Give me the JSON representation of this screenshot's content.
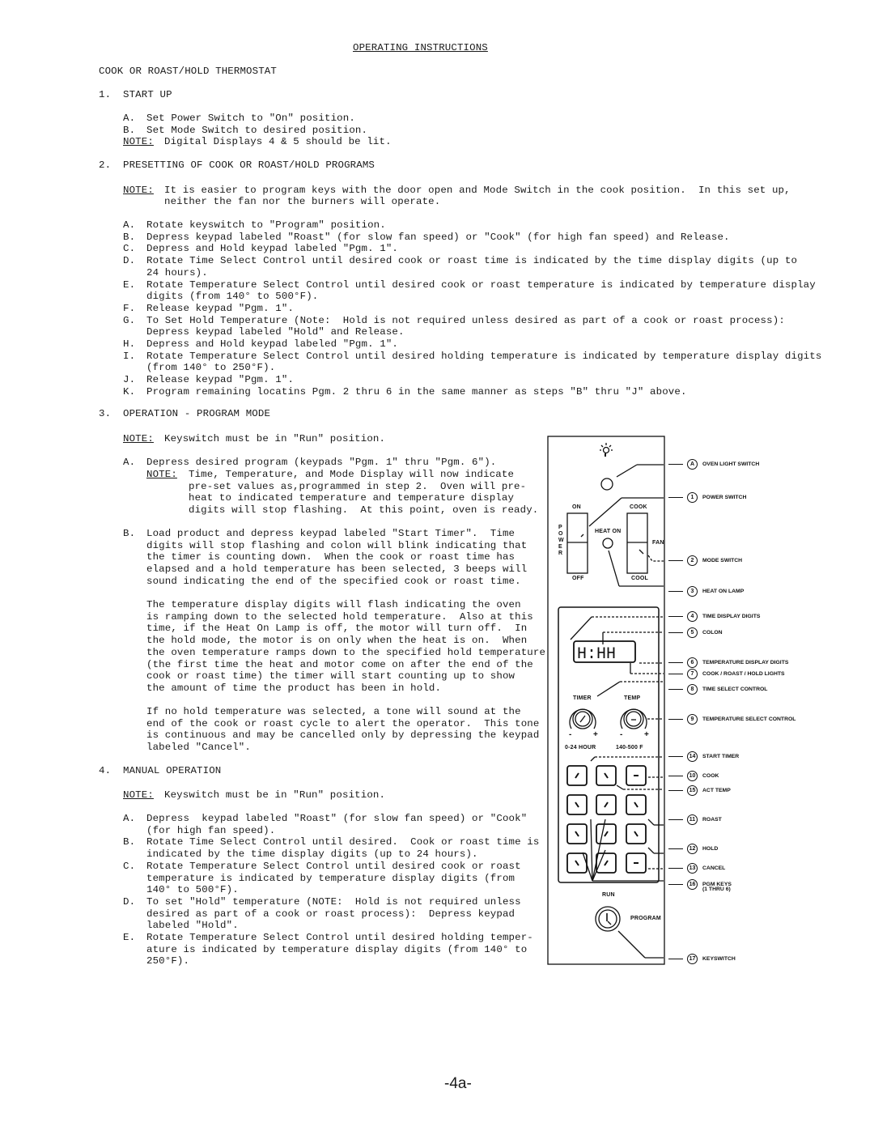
{
  "document": {
    "title": "OPERATING INSTRUCTIONS",
    "heading": "COOK OR ROAST/HOLD THERMOSTAT",
    "page_number": "-4a-",
    "sections": [
      {
        "number": "1.",
        "title": "START UP",
        "items": [
          {
            "letter": "A.",
            "text": "Set Power Switch to \"On\" position."
          },
          {
            "letter": "B.",
            "text": "Set Mode Switch to desired position."
          }
        ],
        "note_label": "NOTE:",
        "note": "Digital Displays 4 & 5 should be lit."
      },
      {
        "number": "2.",
        "title": "PRESETTING OF COOK OR ROAST/HOLD PROGRAMS",
        "note_label": "NOTE:",
        "note_lines": [
          "It is easier to program keys with the door open and Mode Switch in the cook position.  In this set up,",
          "neither the fan nor the burners will operate."
        ],
        "items": [
          {
            "letter": "A.",
            "lines": [
              "Rotate keyswitch to \"Program\" position."
            ]
          },
          {
            "letter": "B.",
            "lines": [
              "Depress keypad labeled \"Roast\" (for slow fan speed) or \"Cook\" (for high fan speed) and Release."
            ]
          },
          {
            "letter": "C.",
            "lines": [
              "Depress and Hold keypad labeled \"Pgm. 1\"."
            ]
          },
          {
            "letter": "D.",
            "lines": [
              "Rotate Time Select Control until desired cook or roast time is indicated by the time display digits (up to",
              "24 hours)."
            ]
          },
          {
            "letter": "E.",
            "lines": [
              "Rotate Temperature Select Control until desired cook or roast temperature is indicated by temperature display",
              "digits (from 140° to 500°F)."
            ]
          },
          {
            "letter": "F.",
            "lines": [
              "Release keypad \"Pgm. 1\"."
            ]
          },
          {
            "letter": "G.",
            "lines": [
              "To Set Hold Temperature (Note:  Hold is not required unless desired as part of a cook or roast process):",
              "Depress keypad labeled \"Hold\" and Release."
            ]
          },
          {
            "letter": "H.",
            "lines": [
              "Depress and Hold keypad labeled \"Pgm. 1\"."
            ]
          },
          {
            "letter": "I.",
            "lines": [
              "Rotate Temperature Select Control until desired holding temperature is indicated by temperature display digits",
              "(from 140° to 250°F)."
            ]
          },
          {
            "letter": "J.",
            "lines": [
              "Release keypad \"Pgm. 1\"."
            ]
          },
          {
            "letter": "K.",
            "lines": [
              "Program remaining locatins Pgm. 2 thru 6 in the same manner as steps \"B\" thru \"J\" above."
            ]
          }
        ]
      },
      {
        "number": "3.",
        "title": "OPERATION - PROGRAM MODE",
        "note_label": "NOTE:",
        "note": "Keyswitch must be in \"Run\" position.",
        "items": [
          {
            "letter": "A.",
            "lines": [
              "Depress desired program (keypads \"Pgm. 1\" thru \"Pgm. 6\")."
            ],
            "sub_note_label": "NOTE:",
            "sub_note_lines": [
              "Time, Temperature, and Mode Display will now indicate",
              "pre-set values as,programmed in step 2.  Oven will pre-",
              "heat to indicated temperature and temperature display",
              "digits will stop flashing.  At this point, oven is ready."
            ]
          },
          {
            "letter": "B.",
            "lines": [
              "Load product and depress keypad labeled \"Start Timer\".  Time",
              "digits will stop flashing and colon will blink indicating that",
              "the timer is counting down.  When the cook or roast time has",
              "elapsed and a hold temperature has been selected, 3 beeps will",
              "sound indicating the end of the specified cook or roast time."
            ]
          }
        ],
        "paragraphs": [
          [
            "The temperature display digits will flash indicating the oven",
            "is ramping down to the selected hold temperature.  Also at this",
            "time, if the Heat On Lamp is off, the motor will turn off.  In",
            "the hold mode, the motor is on only when the heat is on.  When",
            "the oven temperature ramps down to the specified hold temperature",
            "(the first time the heat and motor come on after the end of the",
            "cook or roast time) the timer will start counting up to show",
            "the amount of time the product has been in hold."
          ],
          [
            "If no hold temperature was selected, a tone will sound at the",
            "end of the cook or roast cycle to alert the operator.  This tone",
            "is continuous and may be cancelled only by depressing the keypad",
            "labeled \"Cancel\"."
          ]
        ]
      },
      {
        "number": "4.",
        "title": "MANUAL OPERATION",
        "note_label": "NOTE:",
        "note": "Keyswitch must be in \"Run\" position.",
        "items": [
          {
            "letter": "A.",
            "lines": [
              "Depress  keypad labeled \"Roast\" (for slow fan speed) or \"Cook\"",
              "(for high fan speed)."
            ]
          },
          {
            "letter": "B.",
            "lines": [
              "Rotate Time Select Control until desired.  Cook or roast time is",
              "indicated by the time display digits (up to 24 hours)."
            ]
          },
          {
            "letter": "C.",
            "lines": [
              "Rotate Temperature Select Control until desired cook or roast",
              "temperature is indicated by temperature display digits (from",
              "140° to 500°F)."
            ]
          },
          {
            "letter": "D.",
            "lines": [
              "To set \"Hold\" temperature (NOTE:  Hold is not required unless",
              "desired as part of a cook or roast process):  Depress keypad",
              "labeled \"Hold\"."
            ]
          },
          {
            "letter": "E.",
            "lines": [
              "Rotate Temperature Select Control until desired holding temper-",
              "ature is indicated by temperature display digits (from 140° to",
              "250°F)."
            ]
          }
        ]
      }
    ]
  },
  "diagram": {
    "panel_labels": {
      "power_on": "ON",
      "power_off": "OFF",
      "power_vertical": "POWER",
      "heat_on": "HEAT ON",
      "mode_cook": "COOK",
      "mode_cool": "COOL",
      "fan": "FAN",
      "display": "H:HH",
      "timer": "TIMER",
      "temp": "TEMP",
      "minus": "-",
      "plus": "+",
      "time_range": "0-24 HOUR",
      "temp_range": "140-500 F",
      "run": "RUN",
      "program": "PROGRAM"
    },
    "callouts": [
      {
        "num": "A",
        "label": "OVEN LIGHT SWITCH"
      },
      {
        "num": "1",
        "label": "POWER SWITCH"
      },
      {
        "num": "2",
        "label": "MODE SWITCH"
      },
      {
        "num": "3",
        "label": "HEAT ON LAMP"
      },
      {
        "num": "4",
        "label": "TIME DISPLAY DIGITS"
      },
      {
        "num": "5",
        "label": "COLON"
      },
      {
        "num": "6",
        "label": "TEMPERATURE DISPLAY DIGITS"
      },
      {
        "num": "7",
        "label": "COOK / ROAST / HOLD LIGHTS"
      },
      {
        "num": "8",
        "label": "TIME SELECT CONTROL"
      },
      {
        "num": "9",
        "label": "TEMPERATURE SELECT CONTROL"
      },
      {
        "num": "14",
        "label": "START TIMER"
      },
      {
        "num": "10",
        "label": "COOK"
      },
      {
        "num": "15",
        "label": "ACT TEMP"
      },
      {
        "num": "11",
        "label": "ROAST"
      },
      {
        "num": "12",
        "label": "HOLD"
      },
      {
        "num": "13",
        "label": "CANCEL"
      },
      {
        "num": "16",
        "label": "PGM KEYS",
        "label2": "(1 THRU 6)"
      },
      {
        "num": "17",
        "label": "KEYSWITCH"
      }
    ]
  }
}
